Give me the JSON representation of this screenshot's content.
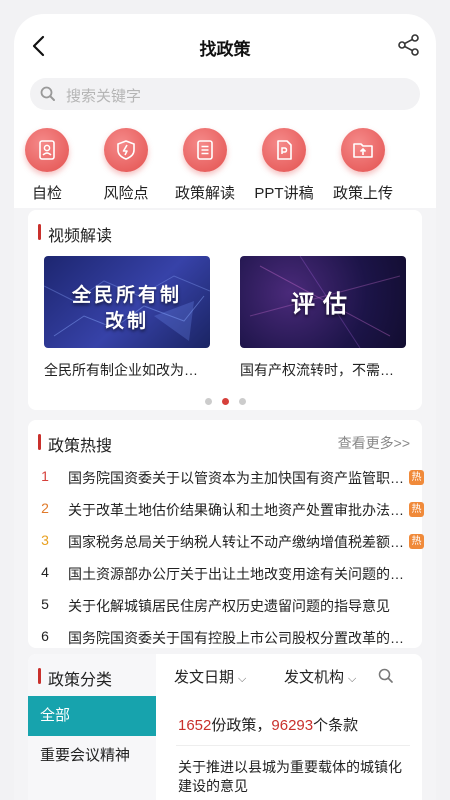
{
  "header": {
    "title": "找政策",
    "back_icon": "back-arrow-icon",
    "share_icon": "share-icon"
  },
  "search": {
    "placeholder": "搜索关键字"
  },
  "quick_actions": [
    {
      "label": "自检",
      "icon": "id-card-icon"
    },
    {
      "label": "风险点",
      "icon": "shield-lightning-icon"
    },
    {
      "label": "政策解读",
      "icon": "document-list-icon"
    },
    {
      "label": "PPT讲稿",
      "icon": "ppt-file-icon"
    },
    {
      "label": "政策上传",
      "icon": "upload-folder-icon"
    }
  ],
  "video_section": {
    "title": "视频解读",
    "videos": [
      {
        "thumb_line1": "全民所有制",
        "thumb_line2": "改制",
        "caption": "全民所有制企业如改为有限责任公司…"
      },
      {
        "thumb_line1": "评估",
        "thumb_line2": "",
        "caption": "国有产权流转时，不需要评估的情况…"
      }
    ],
    "page_count": 3,
    "active_page": 2
  },
  "hot_section": {
    "title": "政策热搜",
    "more_label": "查看更多>>",
    "badge_label": "热",
    "items": [
      {
        "rank": "1",
        "text": "国务院国资委关于以管资本为主加快国有资产监管职能转变的实施意见",
        "hot": true
      },
      {
        "rank": "2",
        "text": "关于改革土地估价结果确认和土地资产处置审批办法的通知",
        "hot": true
      },
      {
        "rank": "3",
        "text": "国家税务总局关于纳税人转让不动产缴纳增值税差额扣除有关问题",
        "hot": true
      },
      {
        "rank": "4",
        "text": "国土资源部办公厅关于出让土地改变用途有关问题的复函",
        "hot": false
      },
      {
        "rank": "5",
        "text": "关于化解城镇居民住房产权历史遗留问题的指导意见",
        "hot": false
      },
      {
        "rank": "6",
        "text": "国务院国资委关于国有控股上市公司股权分置改革的指导意见",
        "hot": false
      }
    ]
  },
  "category_section": {
    "title": "政策分类",
    "items": [
      "全部",
      "重要会议精神"
    ],
    "filters": [
      "发文日期",
      "发文机构"
    ],
    "policy_count": "1652",
    "policy_unit": "份政策，",
    "clause_count": "96293",
    "clause_unit": "个条款",
    "first_doc": "关于推进以县城为重要载体的城镇化建设的意见"
  },
  "colors": {
    "accent_red": "#c9302c",
    "active_teal": "#17a3ad",
    "hot_orange": "#f08a3a"
  }
}
